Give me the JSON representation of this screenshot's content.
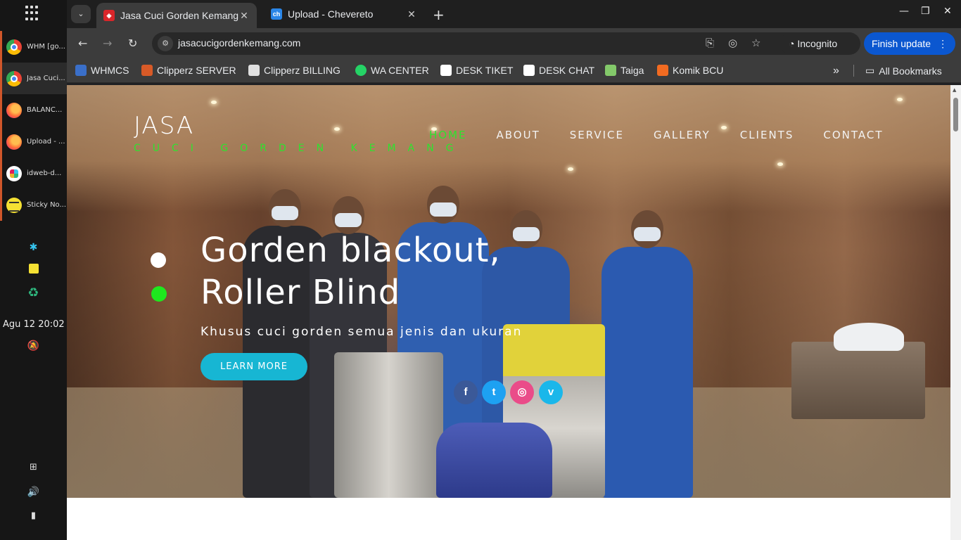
{
  "taskbar": {
    "tasks": [
      {
        "label": "WHM [go...",
        "icon": "chrome-icon"
      },
      {
        "label": "Jasa Cuci...",
        "icon": "chrome-icon"
      },
      {
        "label": "BALANC...",
        "icon": "firefox-icon"
      },
      {
        "label": "Upload - ...",
        "icon": "firefox-icon"
      },
      {
        "label": "idweb-d...",
        "icon": "slack-icon"
      },
      {
        "label": "Sticky No...",
        "icon": "sticky-icon"
      }
    ],
    "clock": "Agu 12  20:02"
  },
  "browser": {
    "tabs": [
      {
        "title": "Jasa Cuci Gorden Kemang",
        "favicon": "site-favicon",
        "close": "✕"
      },
      {
        "title": "Upload - Chevereto",
        "favicon": "ch",
        "close": "✕"
      }
    ],
    "url": "jasacucigordenkemang.com",
    "incognito_label": "Incognito",
    "finish_update_label": "Finish update",
    "bookmarks": [
      {
        "label": "WHMCS",
        "color": "#3a6fc9"
      },
      {
        "label": "Clipperz SERVER",
        "color": "#d85a27"
      },
      {
        "label": "Clipperz BILLING",
        "color": "#e0e0e0"
      },
      {
        "label": "WA CENTER",
        "color": "#25d366"
      },
      {
        "label": "DESK TIKET",
        "color": "#ffffff"
      },
      {
        "label": "DESK CHAT",
        "color": "#ffffff"
      },
      {
        "label": "Taiga",
        "color": "#83c96a"
      },
      {
        "label": "Komik BCU",
        "color": "#f26b21"
      }
    ],
    "all_bookmarks_label": "All Bookmarks"
  },
  "site": {
    "brand_title": "JASA",
    "brand_subtitle": "CUCI GORDEN KEMANG",
    "nav": [
      "HOME",
      "ABOUT",
      "SERVICE",
      "GALLERY",
      "CLIENTS",
      "CONTACT"
    ],
    "nav_active": "HOME",
    "headline_line1": "Gorden blackout,",
    "headline_line2": "Roller Blind",
    "subheadline": "Khusus cuci gorden semua jenis dan ukuran",
    "cta_label": "LEARN MORE",
    "social": [
      {
        "name": "facebook-icon",
        "glyph": "f",
        "color": "#3b5998"
      },
      {
        "name": "twitter-icon",
        "glyph": "t",
        "color": "#1da1f2"
      },
      {
        "name": "dribbble-icon",
        "glyph": "◎",
        "color": "#ea4c89"
      },
      {
        "name": "vimeo-icon",
        "glyph": "v",
        "color": "#1ab7ea"
      }
    ],
    "accent_green": "#2ee32e",
    "accent_cyan": "#17b6d3"
  }
}
